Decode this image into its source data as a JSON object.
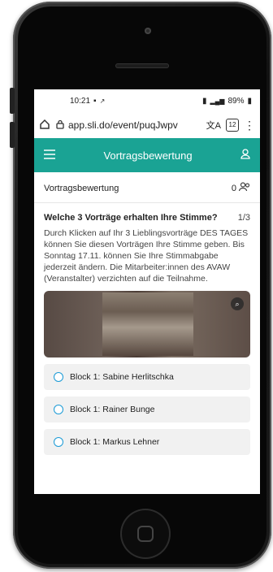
{
  "status_bar": {
    "time": "10:21",
    "left_icons": [
      "message-icon",
      "signal-extra-icon"
    ],
    "right_icons": [
      "vibrate-icon",
      "signal-icon"
    ],
    "battery": "89%"
  },
  "browser": {
    "url": "app.sli.do/event/puqJwpv",
    "tab_count": "12"
  },
  "app_bar": {
    "title": "Vortragsbewertung",
    "accent_color": "#1aa394"
  },
  "poll": {
    "title": "Vortragsbewertung",
    "participants": "0"
  },
  "question": {
    "heading": "Welche 3 Vorträge erhalten Ihre Stimme?",
    "counter": "1/3",
    "description": "Durch Klicken auf Ihr 3 Lieblingsvorträge DES TAGES können Sie diesen Vorträgen Ihre Stimme geben. Bis Sonntag 17.11. können Sie Ihre Stimmabgabe jederzeit ändern. Die Mitarbeiter:innen des AVAW (Veranstalter) verzichten auf die Teilnahme."
  },
  "options": [
    {
      "label": "Block 1: Sabine Herlitschka"
    },
    {
      "label": "Block 1: Rainer Bunge"
    },
    {
      "label": "Block 1: Markus Lehner"
    }
  ]
}
